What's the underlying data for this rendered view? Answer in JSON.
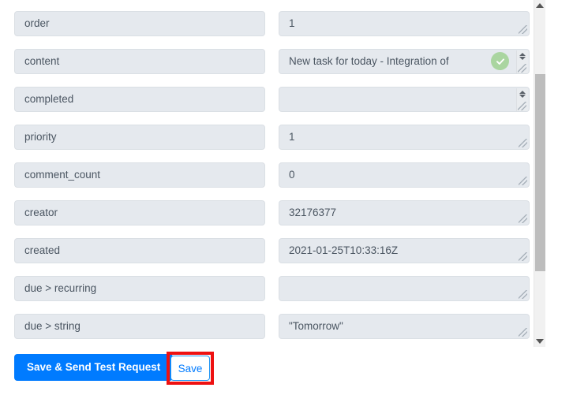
{
  "form": {
    "rows": [
      {
        "key": "order",
        "value": "1",
        "has_grip": true,
        "has_spinner": false,
        "has_check": false
      },
      {
        "key": "content",
        "value": "New task for today - Integration of",
        "has_grip": true,
        "has_spinner": true,
        "has_check": true
      },
      {
        "key": "completed",
        "value": "",
        "has_grip": true,
        "has_spinner": true,
        "has_check": false
      },
      {
        "key": "priority",
        "value": "1",
        "has_grip": true,
        "has_spinner": false,
        "has_check": false
      },
      {
        "key": "comment_count",
        "value": "0",
        "has_grip": true,
        "has_spinner": false,
        "has_check": false
      },
      {
        "key": "creator",
        "value": "32176377",
        "has_grip": true,
        "has_spinner": false,
        "has_check": false
      },
      {
        "key": "created",
        "value": "2021-01-25T10:33:16Z",
        "has_grip": true,
        "has_spinner": false,
        "has_check": false
      },
      {
        "key": "due > recurring",
        "value": "",
        "has_grip": true,
        "has_spinner": false,
        "has_check": false
      },
      {
        "key": "due > string",
        "value": "\"Tomorrow\"",
        "has_grip": true,
        "has_spinner": false,
        "has_check": false
      }
    ]
  },
  "scrollbar": {
    "up_arrow": "scroll-up-arrow",
    "down_arrow": "scroll-down-arrow"
  },
  "footer": {
    "save_send_label": "Save & Send Test Request",
    "save_label": "Save"
  },
  "icons": {
    "success_check": "check-circle-icon",
    "resize_grip": "resize-grip-icon",
    "spinner": "number-spinner-icon"
  },
  "colors": {
    "primary": "#007bff",
    "highlight": "#ee1111",
    "success": "#aad5a0",
    "field_bg": "#e5e9ee"
  }
}
